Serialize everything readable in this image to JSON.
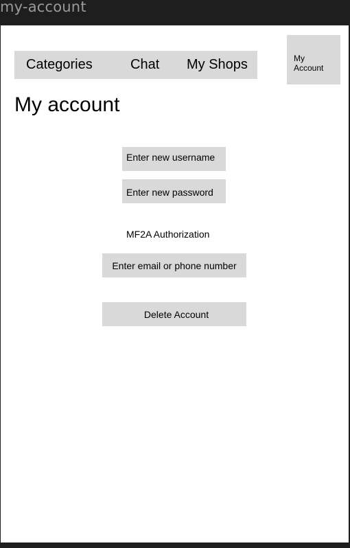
{
  "frame": {
    "title": "my-account"
  },
  "nav": {
    "items": [
      {
        "label": "Categories"
      },
      {
        "label": "Chat"
      },
      {
        "label": "My Shops"
      }
    ]
  },
  "account_button": {
    "line1": "My",
    "line2": "Account"
  },
  "main": {
    "title": "My account",
    "username_field": {
      "placeholder": "Enter new username"
    },
    "password_field": {
      "placeholder": "Enter new password"
    },
    "mf2a_label": "MF2A Authorization",
    "contact_field": {
      "placeholder": "Enter email or phone number"
    },
    "delete_button": {
      "label": "Delete Account"
    }
  },
  "colors": {
    "outer_background": "#1e1e1e",
    "frame_background": "#ffffff",
    "control_fill": "#d9d9d9",
    "frame_title_text": "#9a9a9a"
  }
}
